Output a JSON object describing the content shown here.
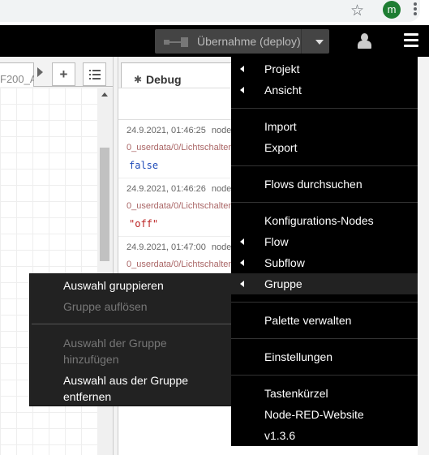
{
  "browser": {
    "star_icon": "star-icon",
    "profile_initial": "m",
    "profile_color": "#1e7d32"
  },
  "header": {
    "deploy_label": "Übernahme (deploy)",
    "deploy_caret_icon": "caret-down-icon",
    "user_icon": "user-icon",
    "menu_icon": "hamburger-menu-icon"
  },
  "workspace": {
    "flow_tab_label": "F200_A",
    "add_tab_label": "+",
    "list_tabs_icon": "list-icon"
  },
  "sidebar": {
    "debug_tab_label": "Debug",
    "messages": [
      {
        "timestamp": "24.9.2021, 01:46:25",
        "node": "node",
        "topic": "0_userdata/0/Lichtschalter",
        "value": "false"
      },
      {
        "timestamp": "24.9.2021, 01:46:26",
        "node": "node",
        "topic": "0_userdata/0/Lichtschalter",
        "value": "\"off\""
      },
      {
        "timestamp": "24.9.2021, 01:47:00",
        "node": "node",
        "topic": "0_userdata/0/Lichtschalter",
        "value": ""
      }
    ]
  },
  "context_menu": {
    "items": [
      {
        "label": "Auswahl gruppieren",
        "enabled": true
      },
      {
        "label": "Gruppe auflösen",
        "enabled": false
      },
      {
        "label_line1": "Auswahl der Gruppe",
        "label_line2": "hinzufügen",
        "enabled": false
      },
      {
        "label_line1": "Auswahl aus der Gruppe",
        "label_line2": "entfernen",
        "enabled": true
      }
    ]
  },
  "main_menu": {
    "items": [
      {
        "label": "Projekt",
        "submenu": true
      },
      {
        "label": "Ansicht",
        "submenu": true
      },
      {
        "label": "Import",
        "submenu": false
      },
      {
        "label": "Export",
        "submenu": false
      },
      {
        "label": "Flows durchsuchen",
        "submenu": false
      },
      {
        "label": "Konfigurations-Nodes",
        "submenu": false
      },
      {
        "label": "Flow",
        "submenu": true
      },
      {
        "label": "Subflow",
        "submenu": true
      },
      {
        "label": "Gruppe",
        "submenu": true,
        "active": true
      },
      {
        "label": "Palette verwalten",
        "submenu": false
      },
      {
        "label": "Einstellungen",
        "submenu": false
      },
      {
        "label": "Tastenkürzel",
        "submenu": false
      },
      {
        "label": "Node-RED-Website",
        "submenu": false
      },
      {
        "label": "v1.3.6",
        "submenu": false
      }
    ]
  }
}
